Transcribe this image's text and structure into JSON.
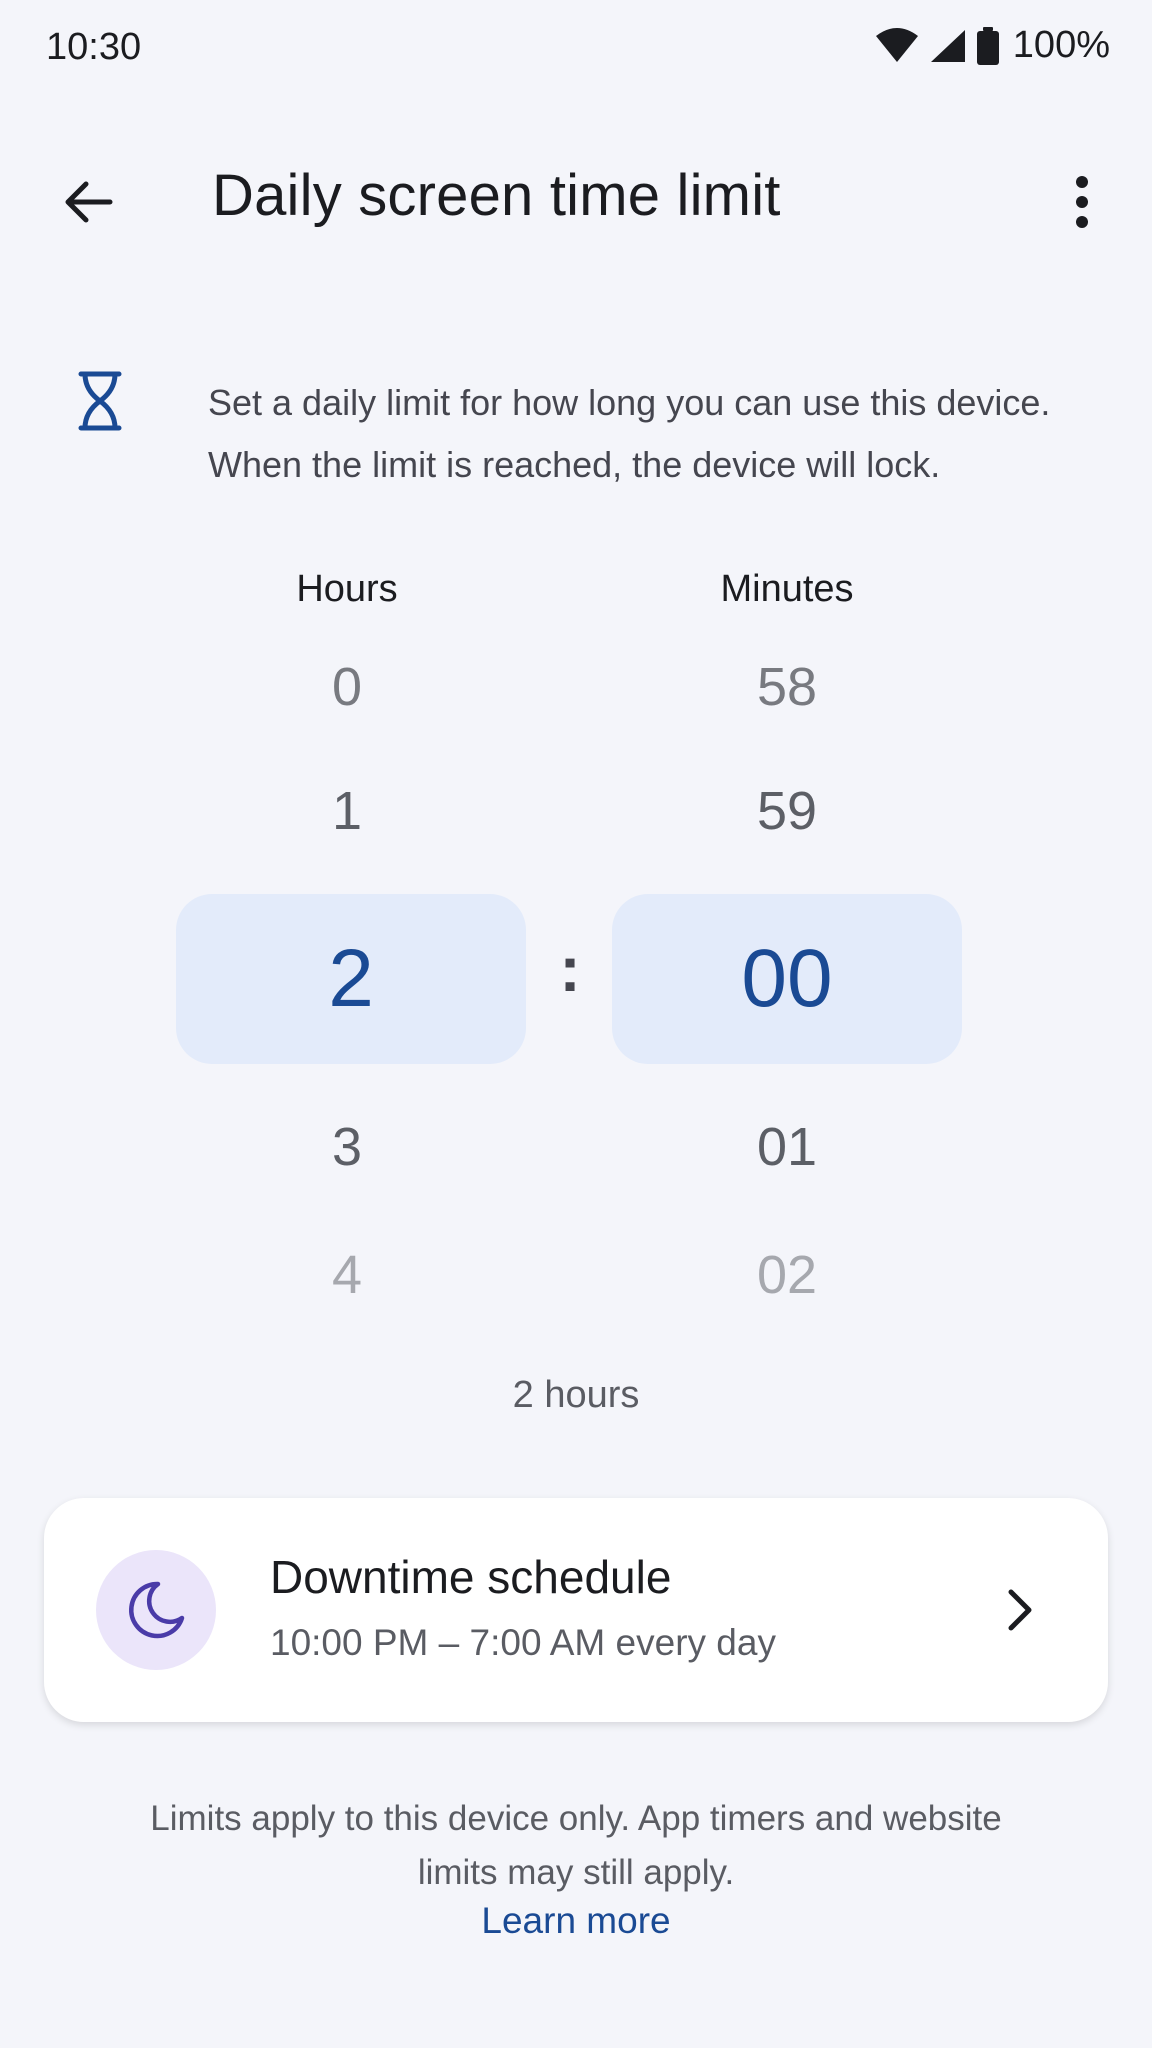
{
  "status_bar": {
    "time": "10:30",
    "battery": "100%",
    "icons": [
      "wifi-icon",
      "signal-icon",
      "battery-icon"
    ]
  },
  "app_bar": {
    "title": "Daily screen time limit",
    "back_icon": "arrow-back-icon",
    "menu_icon": "more-vert-icon"
  },
  "info": {
    "icon": "hourglass-icon",
    "line1": "Set a daily limit for how long you can use this device.",
    "line2": "When the limit is reached, the device will lock."
  },
  "picker": {
    "hours_label": "Hours",
    "minutes_label": "Minutes",
    "hours": {
      "above2": "0",
      "above1": "1",
      "selected": "2",
      "below1": "3",
      "below2": "4"
    },
    "minutes": {
      "above2": "58",
      "above1": "59",
      "selected": "00",
      "below1": "01",
      "below2": "02"
    },
    "separator": ":",
    "summary": "2 hours"
  },
  "downtime_card": {
    "icon": "moon-icon",
    "title": "Downtime schedule",
    "subtitle": "10:00 PM – 7:00 AM every day",
    "chevron": "chevron-right-icon"
  },
  "footer": {
    "line1": "Limits apply to this device only. App timers and website",
    "line2": "limits may still apply.",
    "learn_more": "Learn more"
  },
  "colors": {
    "background": "#f4f5fa",
    "accent": "#1a4a94",
    "selected_bg": "#e3ebfa",
    "moon_bg": "#ebe5fa",
    "moon": "#4a3ba8"
  }
}
